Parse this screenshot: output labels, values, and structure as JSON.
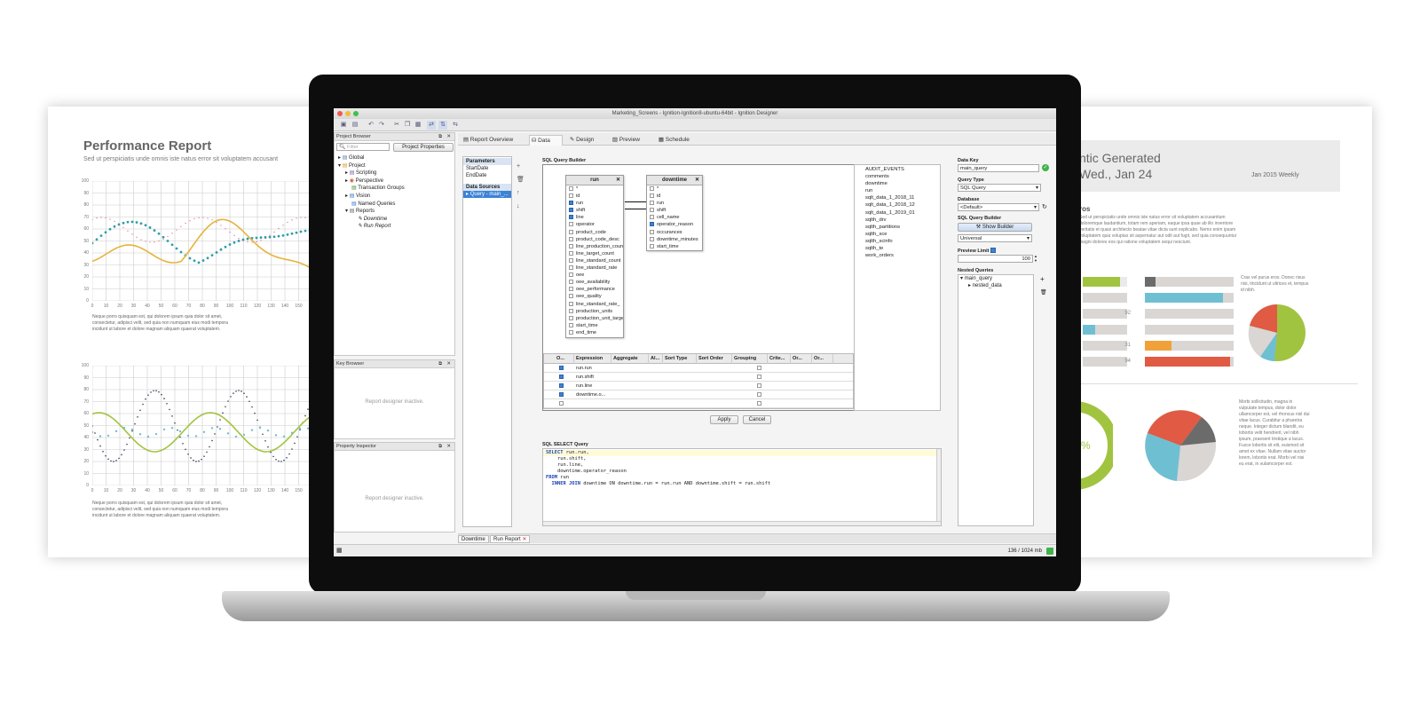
{
  "left_report": {
    "title": "Performance Report",
    "subtitle": "Sed ut perspiciatis unde omnis iste natus error sit voluptatem accusant",
    "caption1": "Neque porro quisquam est, qui dolorem ipsum quia dolor sit amet, consectetur, adipisci velit, sed quia non numquam eius modi tempora incidunt ut labore et dolore magnam aliquam quaerat voluptatem.",
    "caption2": "Neque porro quisquam est, qui dolorem ipsum quia dolor sit amet, consectetur, adipisci velit, sed quia non numquam eius modi tempora incidunt ut labore et dolore magnam aliquam quaerat voluptatem.",
    "y_ticks": [
      "100",
      "90",
      "80",
      "70",
      "60",
      "50",
      "40",
      "30",
      "20",
      "10",
      "0"
    ],
    "x_ticks": [
      "0",
      "10",
      "20",
      "30",
      "40",
      "50",
      "60",
      "70",
      "80",
      "90",
      "100",
      "110",
      "120",
      "130",
      "140",
      "150",
      "160",
      "170",
      "18"
    ]
  },
  "right_report": {
    "title_line1": "ntic Generated",
    "title_line2": "Wed., Jan 24",
    "tag": "Jan 2015 Weekly",
    "heading": "ros",
    "intro": "Sed ut perspiciatis unde omnis iste natus error sit voluptatem accusantium doloremque laudantium, totam rem aperiam, eaque ipsa quae ab illo inventore veritatis et quasi architecto beatae vitae dicta sunt explicabo. Nemo enim ipsam voluptatem quia voluptas sit aspernatur aut odit aut fugit, sed quia consequuntur magni dolores eos qui ratione voluptatem sequi nesciunt.",
    "side_note": "Cras vel purus eros. Donec risus nisi, tincidunt ut ultrices et, tempus id nibh.",
    "values": [
      "92",
      "31",
      "94"
    ],
    "bottom_text": "Morbi sollicitudin, magna in vulputate tempus, dolor dolor ullamcorper est, vel rhoncus nisl dui vitae lacus. Curabitur a pharetra neque. Integer dictum blandit, eu lobortis velit hendrerit, vel nibh ipsum, praesent tristique a lacus. Fusce lobortis sit elit, euismod sit amet ex vitae. Nullam vitae auctor lorem, lobortis erat. Morbi vel nisi eu erat, in vulamcorper est."
  },
  "app": {
    "window_title": "Marketing_Screens - Ignition-Ignition8-ubuntu-64bit - Ignition Designer",
    "project_browser": {
      "title": "Project Browser",
      "filter_placeholder": "Filter",
      "properties_button": "Project Properties",
      "tree": [
        "Global",
        "Project",
        "Scripting",
        "Perspective",
        "Transaction Groups",
        "Vision",
        "Named Queries",
        "Reports",
        "Downtime",
        "Run Report"
      ]
    },
    "key_browser": {
      "title": "Key Browser",
      "status": "Report designer inactive."
    },
    "property_inspector": {
      "title": "Property Inspector",
      "status": "Report designer inactive."
    },
    "tabs": [
      "Report Overview",
      "Data",
      "Design",
      "Preview",
      "Schedule"
    ],
    "parameters": {
      "header": "Parameters",
      "items": [
        "StartDate",
        "EndDate"
      ]
    },
    "data_sources": {
      "header": "Data Sources",
      "items": [
        "Query - main_..."
      ]
    },
    "sql_builder_label": "SQL Query Builder",
    "run_table": {
      "title": "run",
      "fields": [
        {
          "name": "*",
          "checked": false
        },
        {
          "name": "id",
          "checked": false
        },
        {
          "name": "run",
          "checked": true
        },
        {
          "name": "shift",
          "checked": true
        },
        {
          "name": "line",
          "checked": true
        },
        {
          "name": "operator",
          "checked": false
        },
        {
          "name": "product_code",
          "checked": false
        },
        {
          "name": "product_code_desc",
          "checked": false
        },
        {
          "name": "line_production_count",
          "checked": false
        },
        {
          "name": "line_target_count",
          "checked": false
        },
        {
          "name": "line_standard_count",
          "checked": false
        },
        {
          "name": "line_standard_rate",
          "checked": false
        },
        {
          "name": "oee",
          "checked": false
        },
        {
          "name": "oee_availability",
          "checked": false
        },
        {
          "name": "oee_performance",
          "checked": false
        },
        {
          "name": "oee_quality",
          "checked": false
        },
        {
          "name": "line_standard_rate_",
          "checked": false
        },
        {
          "name": "production_units",
          "checked": false
        },
        {
          "name": "production_unit_target",
          "checked": false
        },
        {
          "name": "start_time",
          "checked": false
        },
        {
          "name": "end_time",
          "checked": false
        }
      ]
    },
    "downtime_table": {
      "title": "downtime",
      "fields": [
        {
          "name": "*",
          "checked": false
        },
        {
          "name": "id",
          "checked": false
        },
        {
          "name": "run",
          "checked": false
        },
        {
          "name": "shift",
          "checked": false
        },
        {
          "name": "cell_name",
          "checked": false
        },
        {
          "name": "operator_reason",
          "checked": true
        },
        {
          "name": "occurances",
          "checked": false
        },
        {
          "name": "downtime_minutes",
          "checked": false
        },
        {
          "name": "start_time",
          "checked": false
        }
      ]
    },
    "table_list": [
      "AUDIT_EVENTS",
      "comments",
      "downtime",
      "run",
      "sqlt_data_1_2018_11",
      "sqlt_data_1_2018_12",
      "sqlt_data_1_2019_01",
      "sqlth_drv",
      "sqlth_partitions",
      "sqlth_sce",
      "sqlth_scinfo",
      "sqlth_te",
      "work_orders"
    ],
    "grid": {
      "headers": [
        "O...",
        "Expression",
        "Aggregate",
        "Al...",
        "Sort Type",
        "Sort Order",
        "Grouping",
        "Crite...",
        "Or...",
        "Or..."
      ],
      "rows": [
        "run.run",
        "run.shift",
        "run.line",
        "downtime.o...",
        ""
      ]
    },
    "apply_button": "Apply",
    "cancel_button": "Cancel",
    "sql_select_label": "SQL SELECT Query",
    "sql_lines": [
      {
        "kw": "SELECT",
        "rest": " run.run,"
      },
      {
        "kw": "",
        "rest": "    run.shift,"
      },
      {
        "kw": "",
        "rest": "    run.line,"
      },
      {
        "kw": "",
        "rest": "    downtime.operator_reason"
      },
      {
        "kw": "FROM",
        "rest": " run"
      },
      {
        "kw": "  INNER JOIN",
        "rest": " downtime ON downtime.run = run.run AND downtime.shift = run.shift"
      }
    ],
    "right_panel": {
      "data_key_label": "Data Key",
      "data_key_value": "main_query",
      "query_type_label": "Query Type",
      "query_type_value": "SQL Query",
      "database_label": "Database",
      "database_value": "<Default>",
      "sql_builder_label": "SQL Query Builder",
      "show_builder_button": "Show Builder",
      "dialect_value": "Universal",
      "preview_limit_label": "Preview Limit",
      "preview_limit_value": "100",
      "nested_label": "Nested Queries",
      "nested_items": [
        "main_query",
        "nested_data"
      ]
    },
    "bottom_tabs": [
      "Downtime",
      "Run Report"
    ],
    "memory": "136 / 1024 mb"
  },
  "colors": {
    "accent": "#e6b33a",
    "teal": "#2f9da8",
    "pink": "#d8577a",
    "green": "#a1c440",
    "red": "#e05a44",
    "blue": "#6fbfd3",
    "orange": "#f0a13a",
    "gray": "#d9d6d3",
    "dark": "#6b6b6b",
    "selection": "#3d83d6"
  }
}
